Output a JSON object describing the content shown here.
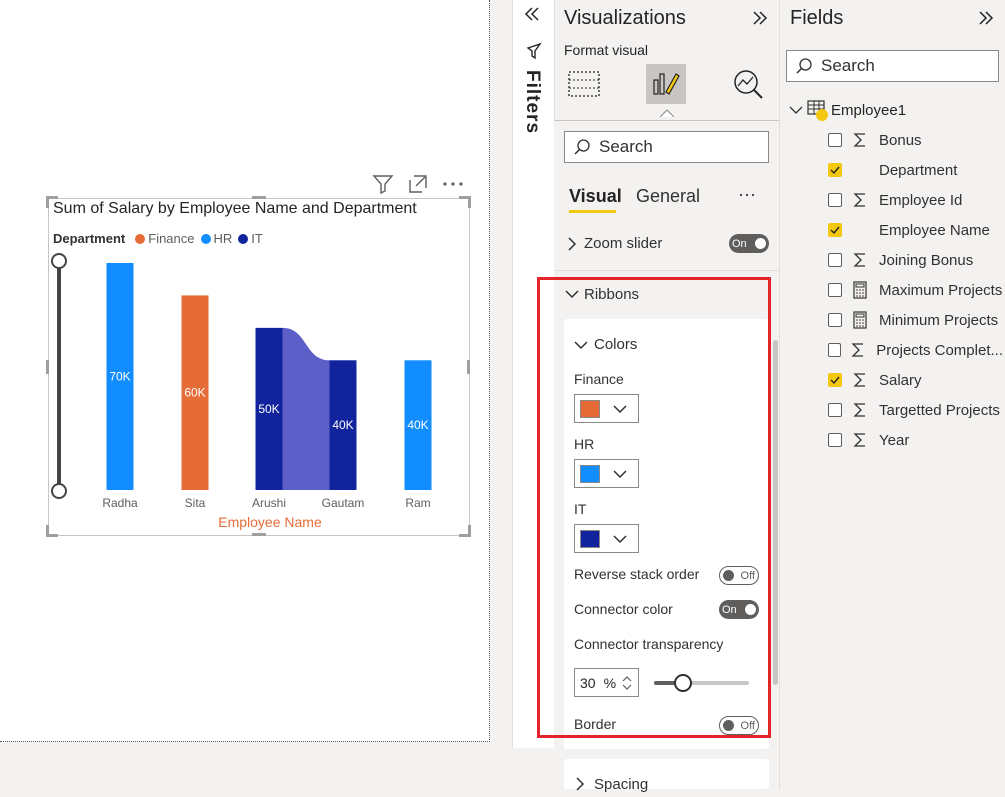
{
  "canvas": {
    "toolbar_icons": [
      "filter-icon",
      "focus-mode-icon",
      "more-options-icon"
    ]
  },
  "chart_data": {
    "type": "bar",
    "title": "Sum of Salary by Employee Name and Department",
    "legend_title": "Department",
    "legend": [
      {
        "name": "Finance",
        "color": "#e66c37"
      },
      {
        "name": "HR",
        "color": "#118dff"
      },
      {
        "name": "IT",
        "color": "#12239e"
      }
    ],
    "xlabel": "Employee Name",
    "ylabel": "",
    "categories": [
      "Radha",
      "Sita",
      "Arushi",
      "Gautam",
      "Ram"
    ],
    "bars": [
      {
        "category": "Radha",
        "series": "HR",
        "value": 70,
        "label": "70K"
      },
      {
        "category": "Sita",
        "series": "Finance",
        "value": 60,
        "label": "60K"
      },
      {
        "category": "Arushi",
        "series": "IT",
        "value": 50,
        "label": "50K"
      },
      {
        "category": "Gautam",
        "series": "IT",
        "value": 40,
        "label": "40K"
      },
      {
        "category": "Ram",
        "series": "HR",
        "value": 40,
        "label": "40K"
      }
    ],
    "ylim": [
      0,
      70
    ],
    "connector_color": "#5b5fc7",
    "grid": false,
    "legend_position": "top-left"
  },
  "filters": {
    "label": "Filters"
  },
  "visualizations": {
    "title": "Visualizations",
    "subtitle": "Format visual",
    "search_placeholder": "Search",
    "tabs": [
      "Visual",
      "General"
    ],
    "more": "···",
    "zoom_slider": {
      "label": "Zoom slider",
      "toggle": "On"
    },
    "ribbons": {
      "label": "Ribbons",
      "colors_label": "Colors",
      "finance_label": "Finance",
      "finance_color": "#e66c37",
      "hr_label": "HR",
      "hr_color": "#118dff",
      "it_label": "IT",
      "it_color": "#12239e",
      "reverse_stack_label": "Reverse stack order",
      "reverse_stack_toggle": "Off",
      "connector_color_label": "Connector color",
      "connector_color_toggle": "On",
      "connector_transparency_label": "Connector transparency",
      "connector_transparency_value": "30",
      "connector_transparency_unit": "%",
      "connector_transparency_level": 0.3,
      "border_label": "Border",
      "border_toggle": "Off"
    },
    "spacing_label": "Spacing"
  },
  "fields": {
    "title": "Fields",
    "search_placeholder": "Search",
    "table_name": "Employee1",
    "items": [
      {
        "name": "Bonus",
        "checked": false,
        "icon": "sigma"
      },
      {
        "name": "Department",
        "checked": true,
        "icon": ""
      },
      {
        "name": "Employee Id",
        "checked": false,
        "icon": "sigma"
      },
      {
        "name": "Employee Name",
        "checked": true,
        "icon": ""
      },
      {
        "name": "Joining Bonus",
        "checked": false,
        "icon": "sigma"
      },
      {
        "name": "Maximum Projects",
        "checked": false,
        "icon": "calculator"
      },
      {
        "name": "Minimum Projects",
        "checked": false,
        "icon": "calculator"
      },
      {
        "name": "Projects Complet...",
        "checked": false,
        "icon": "sigma"
      },
      {
        "name": "Salary",
        "checked": true,
        "icon": "sigma"
      },
      {
        "name": "Targetted Projects",
        "checked": false,
        "icon": "sigma"
      },
      {
        "name": "Year",
        "checked": false,
        "icon": "sigma"
      }
    ]
  }
}
